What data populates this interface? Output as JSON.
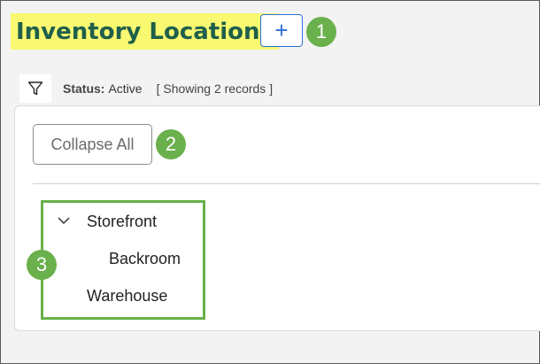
{
  "header": {
    "title": "Inventory Locations",
    "add_label": "+"
  },
  "callouts": [
    "1",
    "2",
    "3"
  ],
  "filter": {
    "status_label": "Status:",
    "status_value": "Active",
    "records_text": "[ Showing 2 records ]"
  },
  "toolbar": {
    "collapse_all_label": "Collapse All"
  },
  "tree": {
    "items": [
      {
        "label": "Storefront",
        "expanded": true
      },
      {
        "label": "Backroom"
      },
      {
        "label": "Warehouse"
      }
    ]
  },
  "colors": {
    "highlight": "#f9f871",
    "title": "#1f5f4b",
    "accent_blue": "#2a6fd6",
    "callout_green": "#6ab04c"
  },
  "icons": {
    "filter": "filter-icon",
    "expand": "chevron-down-icon"
  }
}
